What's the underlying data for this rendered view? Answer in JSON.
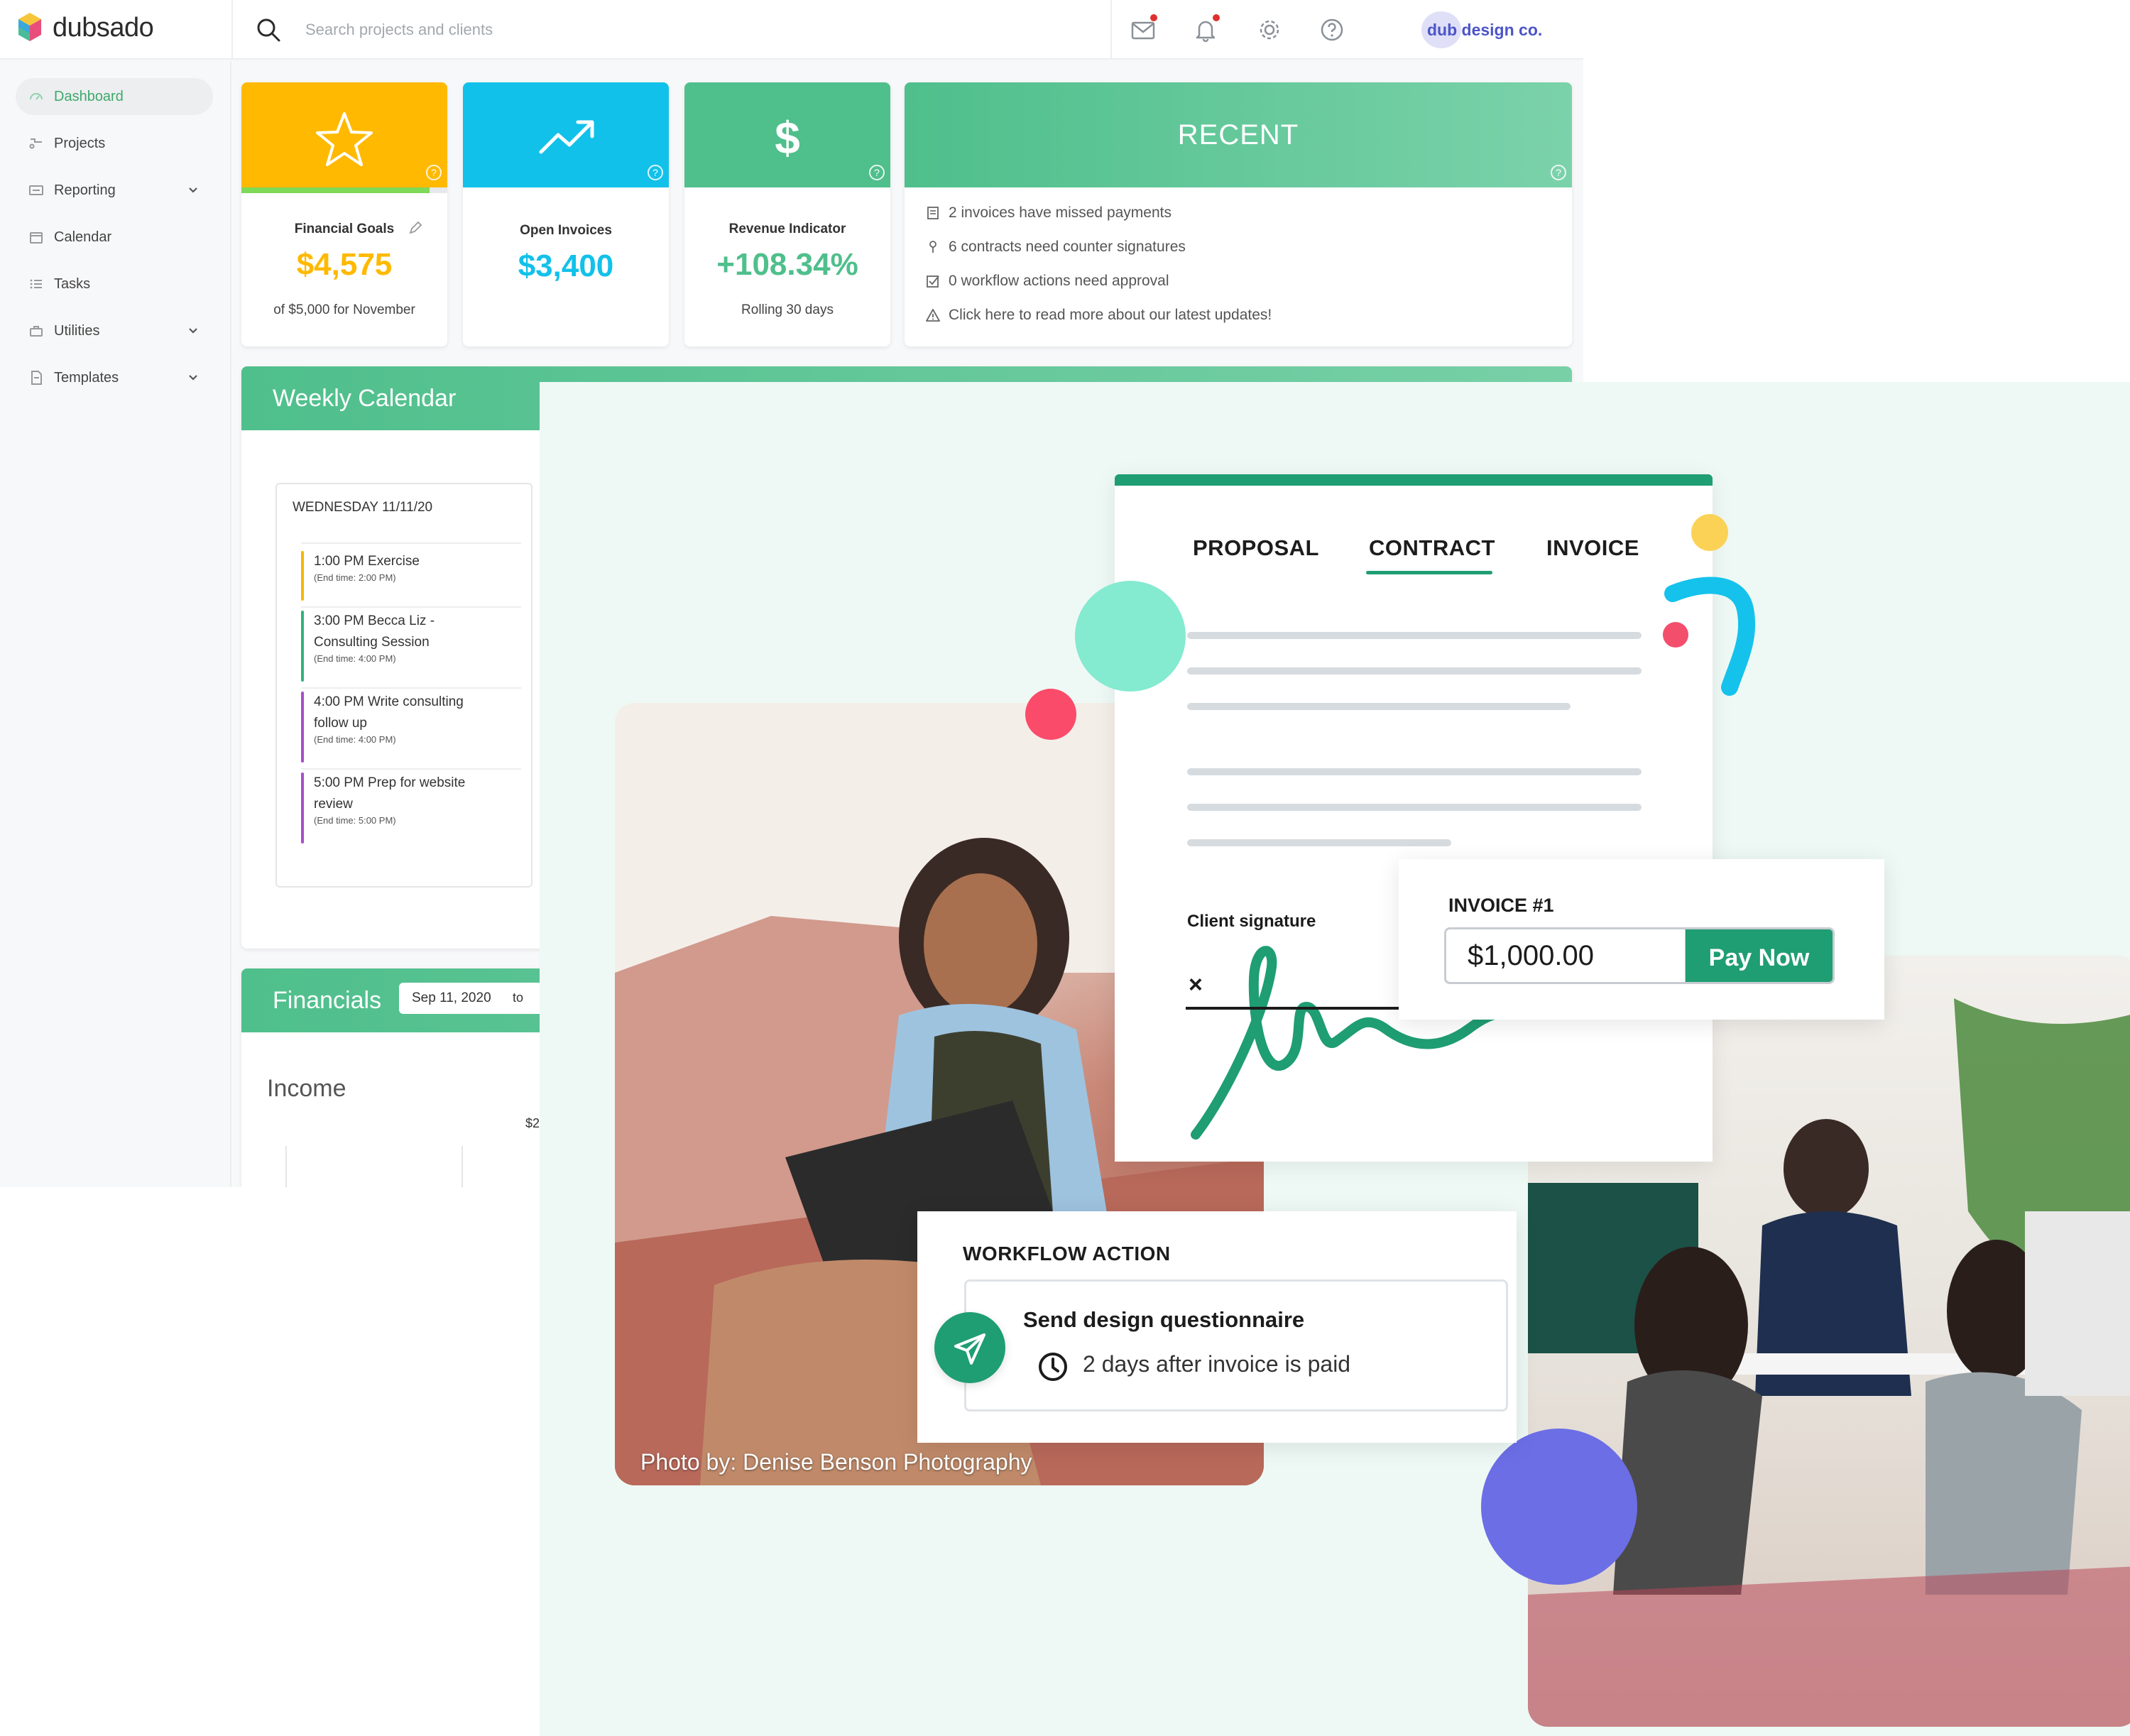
{
  "app": {
    "logo_text": "dubsado",
    "search": {
      "placeholder": "Search projects and clients"
    },
    "brand_badge": "dub design co.",
    "icons": [
      "mail-icon",
      "bell-icon",
      "gear-icon",
      "help-icon"
    ]
  },
  "sidebar": {
    "items": [
      {
        "label": "Dashboard",
        "icon": "dashboard-icon",
        "active": true,
        "expandable": false
      },
      {
        "label": "Projects",
        "icon": "projects-icon",
        "active": false,
        "expandable": false
      },
      {
        "label": "Reporting",
        "icon": "reporting-icon",
        "active": false,
        "expandable": true
      },
      {
        "label": "Calendar",
        "icon": "calendar-icon",
        "active": false,
        "expandable": false
      },
      {
        "label": "Tasks",
        "icon": "tasks-icon",
        "active": false,
        "expandable": false
      },
      {
        "label": "Utilities",
        "icon": "utilities-icon",
        "active": false,
        "expandable": true
      },
      {
        "label": "Templates",
        "icon": "templates-icon",
        "active": false,
        "expandable": true
      }
    ]
  },
  "cards": {
    "financial_goals": {
      "label": "Financial Goals",
      "value": "$4,575",
      "sub": "of $5,000 for November",
      "color": "#ffb900",
      "icon": "star-icon",
      "progress": 0.915
    },
    "open_invoices": {
      "label": "Open Invoices",
      "value": "$3,400",
      "color": "#12c1ea",
      "icon": "trending-up-icon"
    },
    "revenue": {
      "label": "Revenue Indicator",
      "value": "+108.34%",
      "sub": "Rolling 30 days",
      "color": "#4fbf8c",
      "icon": "dollar-icon"
    }
  },
  "recent": {
    "title": "RECENT",
    "items": [
      {
        "text": "2 invoices have missed payments",
        "icon": "invoice-icon"
      },
      {
        "text": "6 contracts need counter signatures",
        "icon": "pen-icon"
      },
      {
        "text": "0 workflow actions need approval",
        "icon": "checkbox-icon"
      },
      {
        "text": "Click here to read more about our latest updates!",
        "icon": "warning-icon"
      }
    ]
  },
  "weekly_calendar": {
    "title": "Weekly Calendar",
    "date": "WEDNESDAY 11/11/20",
    "events": [
      {
        "title": "1:00 PM  Exercise",
        "end": "(End time: 2:00 PM)",
        "color": "#f5b800"
      },
      {
        "title": "3:00 PM  Becca Liz - Consulting Session",
        "end": "(End time: 4:00 PM)",
        "color": "#2fb37a"
      },
      {
        "title": "4:00 PM  Write consulting follow up",
        "end": "(End time: 4:00 PM)",
        "color": "#a64fc8"
      },
      {
        "title": "5:00 PM  Prep for website review",
        "end": "(End time: 5:00 PM)",
        "color": "#a64fc8"
      }
    ]
  },
  "financials": {
    "title": "Financials",
    "date_from": "Sep 11, 2020",
    "to_label": "to",
    "income_label": "Income",
    "axis_tick": "$2"
  },
  "marketing": {
    "doc_tabs": [
      "PROPOSAL",
      "CONTRACT",
      "INVOICE"
    ],
    "active_tab": "CONTRACT",
    "signature_label": "Client signature",
    "signature_x": "×",
    "invoice": {
      "title": "INVOICE #1",
      "amount": "$1,000.00",
      "pay_label": "Pay Now"
    },
    "workflow": {
      "title": "WORKFLOW ACTION",
      "step": "Send design questionnaire",
      "when": "2 days after invoice is paid"
    },
    "photo_credit": "Photo by: Denise Benson Photography",
    "accent_color": "#1f9d73"
  }
}
